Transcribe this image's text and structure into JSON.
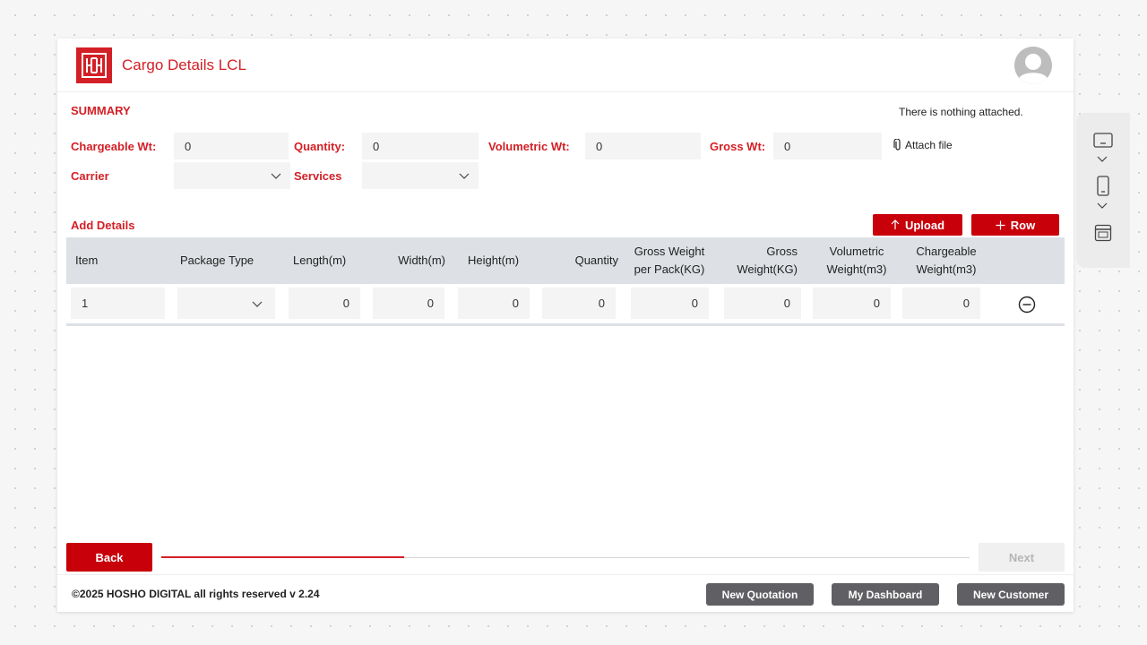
{
  "header": {
    "title": "Cargo Details LCL"
  },
  "summary": {
    "label": "SUMMARY",
    "chargeable_label": "Chargeable Wt:",
    "chargeable_value": "0",
    "quantity_label": "Quantity:",
    "quantity_value": "0",
    "volumetric_label": "Volumetric Wt:",
    "volumetric_value": "0",
    "gross_label": "Gross Wt:",
    "gross_value": "0",
    "carrier_label": "Carrier",
    "services_label": "Services"
  },
  "attachments": {
    "message": "There is nothing attached.",
    "attach_label": "Attach file"
  },
  "details": {
    "label": "Add Details",
    "upload_label": "Upload",
    "row_label": "Row",
    "columns": [
      "Item",
      "Package Type",
      "Length(m)",
      "Width(m)",
      "Height(m)",
      "Quantity",
      "Gross Weight per Pack(KG)",
      "Gross Weight(KG)",
      "Volumetric Weight(m3)",
      "Chargeable Weight(m3)"
    ],
    "rows": [
      {
        "item": "1",
        "package_type": "",
        "length": "0",
        "width": "0",
        "height": "0",
        "quantity": "0",
        "gross_per_pack": "0",
        "gross_weight": "0",
        "volumetric": "0",
        "chargeable": "0"
      }
    ]
  },
  "navigation": {
    "back_label": "Back",
    "next_label": "Next",
    "progress": 0.3
  },
  "footer": {
    "copyright": "©2025 HOSHO DIGITAL all rights reserved v 2.24",
    "new_quotation": "New Quotation",
    "my_dashboard": "My Dashboard",
    "new_customer": "New Customer"
  },
  "colors": {
    "brand": "#d32026",
    "button_red": "#c8000a",
    "button_gray": "#5f5f64",
    "table_header": "#dde1e5"
  }
}
